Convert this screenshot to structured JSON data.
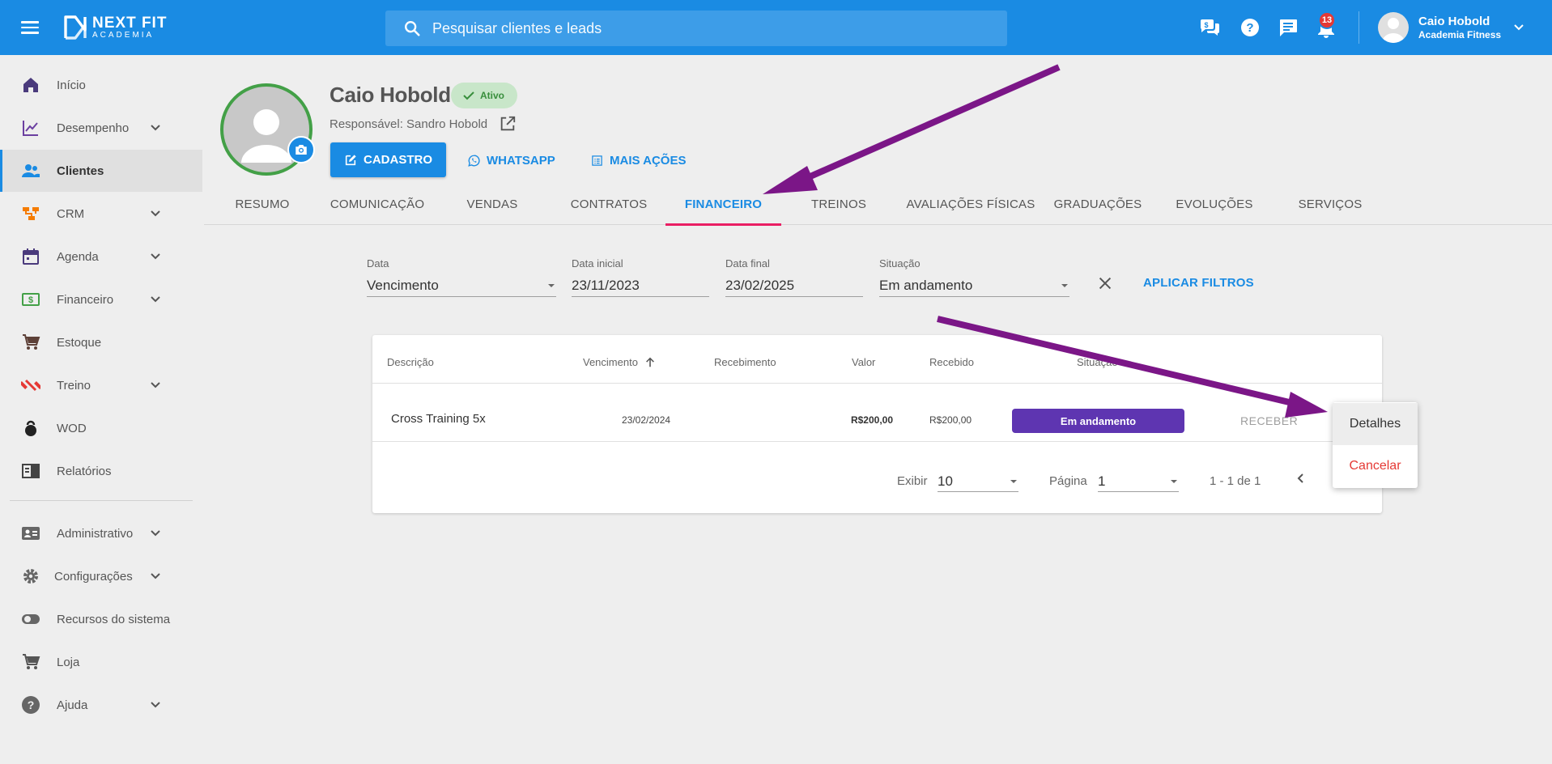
{
  "header": {
    "logo_line1": "NEXT FIT",
    "logo_line2": "ACADEMIA",
    "search_placeholder": "Pesquisar clientes e leads",
    "notification_count": "13",
    "user_name": "Caio Hobold",
    "user_company": "Academia Fitness"
  },
  "sidebar": {
    "items": [
      {
        "label": "Início"
      },
      {
        "label": "Desempenho"
      },
      {
        "label": "Clientes"
      },
      {
        "label": "CRM"
      },
      {
        "label": "Agenda"
      },
      {
        "label": "Financeiro"
      },
      {
        "label": "Estoque"
      },
      {
        "label": "Treino"
      },
      {
        "label": "WOD"
      },
      {
        "label": "Relatórios"
      },
      {
        "label": "Administrativo"
      },
      {
        "label": "Configurações"
      },
      {
        "label": "Recursos do sistema"
      },
      {
        "label": "Loja"
      },
      {
        "label": "Ajuda"
      }
    ]
  },
  "profile": {
    "name": "Caio Hobold",
    "status": "Ativo",
    "responsible": "Responsável: Sandro Hobold",
    "btn_cadastro": "CADASTRO",
    "btn_whatsapp": "WHATSAPP",
    "btn_mais": "MAIS AÇÕES"
  },
  "tabs": [
    {
      "label": "RESUMO"
    },
    {
      "label": "COMUNICAÇÃO"
    },
    {
      "label": "VENDAS"
    },
    {
      "label": "CONTRATOS"
    },
    {
      "label": "FINANCEIRO"
    },
    {
      "label": "TREINOS"
    },
    {
      "label": "AVALIAÇÕES FÍSICAS"
    },
    {
      "label": "GRADUAÇÕES"
    },
    {
      "label": "EVOLUÇÕES"
    },
    {
      "label": "SERVIÇOS"
    }
  ],
  "filters": {
    "data_label": "Data",
    "data_value": "Vencimento",
    "inicial_label": "Data inicial",
    "inicial_value": "23/11/2023",
    "final_label": "Data final",
    "final_value": "23/02/2025",
    "situacao_label": "Situação",
    "situacao_value": "Em andamento",
    "apply": "APLICAR FILTROS"
  },
  "table": {
    "headers": {
      "descricao": "Descrição",
      "vencimento": "Vencimento",
      "recebimento": "Recebimento",
      "valor": "Valor",
      "recebido": "Recebido",
      "situacao": "Situação"
    },
    "rows": [
      {
        "descricao": "Cross Training 5x",
        "vencimento": "23/02/2024",
        "recebimento": "",
        "valor": "R$200,00",
        "recebido": "R$200,00",
        "situacao": "Em andamento",
        "action": "RECEBER"
      }
    ]
  },
  "pagination": {
    "exibir_label": "Exibir",
    "exibir_value": "10",
    "pagina_label": "Página",
    "pagina_value": "1",
    "range": "1 - 1 de 1"
  },
  "popup_menu": {
    "items": [
      {
        "label": "Detalhes"
      },
      {
        "label": "Cancelar"
      }
    ]
  },
  "colors": {
    "primary": "#1a8be3",
    "active_tab_underline": "#e91e63",
    "status_pill": "#5e35b1",
    "annotation_arrow": "#7b1687",
    "danger": "#e53935"
  }
}
